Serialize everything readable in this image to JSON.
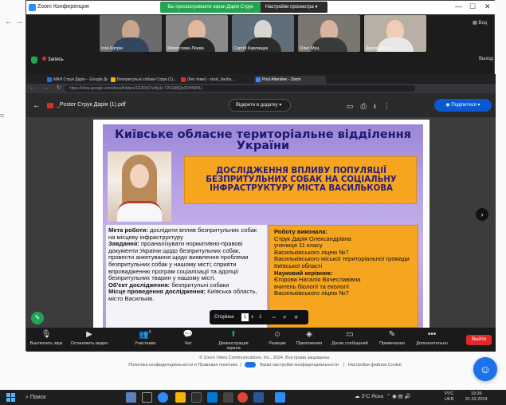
{
  "zoom": {
    "window_title": "Zoom Конференция",
    "share_banner": "Вы просматриваете экран Дарія Струк",
    "share_options": "Настройки просмотра",
    "view_button": "Вид",
    "recording": "Запись",
    "exit_top": "Выход",
    "participants": [
      {
        "name": "Ігор Катрін"
      },
      {
        "name": "Мирослава Лоєва"
      },
      {
        "name": "Сергій Карлащук"
      },
      {
        "name": "Олег Муц"
      },
      {
        "name": "Дарія Струк"
      }
    ],
    "toolbar": {
      "mute": "Выключить звук",
      "video": "Остановить видео",
      "participants": "Участники",
      "participants_count": "5",
      "chat": "Чат",
      "share": "Демонстрация экрана",
      "reactions": "Реакции",
      "apps": "Приложения",
      "whiteboards": "Доски сообщений",
      "notes": "Примечания",
      "more": "Дополнительно",
      "end": "Выйти"
    }
  },
  "browser": {
    "tabs": [
      {
        "label": "МАН Струк Дарія – Google Ди",
        "color": "#1a73e8"
      },
      {
        "label": "Безпритульні собаки Струк (1)...",
        "color": "#f4b400"
      },
      {
        "label": "(без теми) - struk_dasha...",
        "color": "#d93025"
      },
      {
        "label": "Post Attendee - Zoom",
        "color": "#2d8cff"
      }
    ],
    "url": "https://drive.google.com/drive/folders/1G2tXjChx8g1s T2K2d8Qp3SHNW5J"
  },
  "viewer": {
    "file_title": "_Poster Струк Дарія (1).pdf",
    "open_with": "Відкрити в додатку",
    "share_button": "Поділитися",
    "page_label": "Сторінка",
    "page_current": "1",
    "page_sep": "з",
    "page_total": "1"
  },
  "poster": {
    "org_title": "Київське обласне територіальне відділення України",
    "research_title": "ДОСЛІДЖЕННЯ ВПЛИВУ ПОПУЛЯЦІЇ БЕЗПРИТУЛЬНИХ СОБАК НА СОЦІАЛЬНУ ІНФРАСТРУКТУРУ МІСТА ВАСИЛЬКОВА",
    "goal_label": "Мета роботи:",
    "goal_text": " дослідити вплив безпритульних собак на місцеву інфраструктуру",
    "tasks_label": "Завдання:",
    "tasks_text": " проаналізувати нормативно-правові документи України щодо безпритульних собак, провести анкетування щодо виявлення проблеми безпритульних собак у нашому місті; сприяти впровадженню програм соціалізації та адопції безпритульних тварин у нашому місті.",
    "object_label": "Об'єкт дослідження:",
    "object_text": " безпритульні собаки",
    "place_label": "Місце проведення дослідження:",
    "place_text": " Київська область, місто Васильків.",
    "author_label": "Роботу виконала:",
    "author_lines": [
      "Струк Дарія Олександрівна",
      "учениця 11 класу",
      "Васильківського ліцею №7",
      "Васильківського міської територіальної громади",
      "Київської області"
    ],
    "supervisor_label": "Науковий керівник:",
    "supervisor_lines": [
      "Єгорова Наталія Вячеславівна",
      "вчитель біології та екології",
      "Васильківського ліцею №7"
    ]
  },
  "background": {
    "footer_line1": "© Zoom Video Communications, Inc., 2024. Все права защищены.",
    "footer_privacy": "Политика конфиденциальности и Правовая политика",
    "footer_choices": "Ваши настройки конфиденциальности",
    "footer_cookies": "Настройки файлов Cookie"
  },
  "taskbar": {
    "search": "Поиск",
    "weather": "3°C",
    "weather_state": "Ясно",
    "lang_top": "РУС",
    "lang_bottom": "UKR",
    "time": "19:36",
    "date": "21.02.2024"
  }
}
